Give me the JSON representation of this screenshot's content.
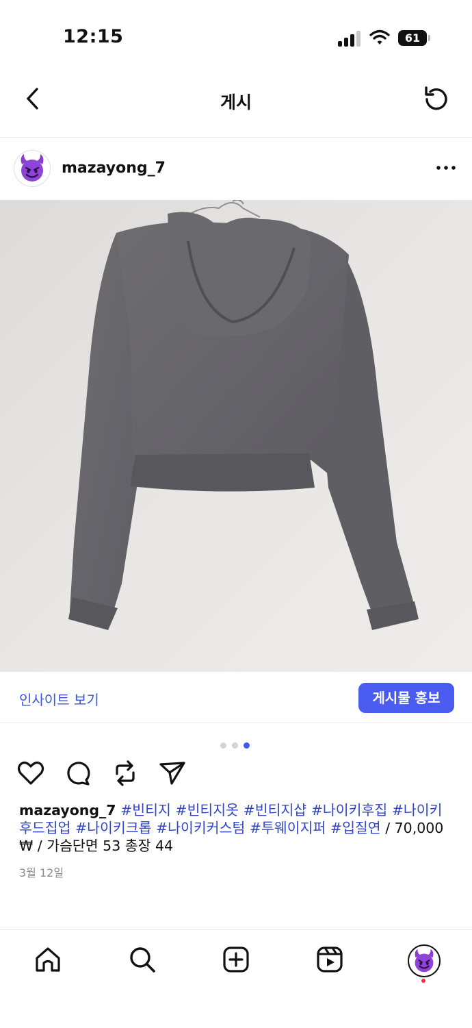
{
  "status_bar": {
    "time": "12:15",
    "battery": "61",
    "signal_bars_filled": 3
  },
  "nav": {
    "title": "게시",
    "back_icon": "chevron-left-icon",
    "refresh_icon": "refresh-icon"
  },
  "post": {
    "username": "mazayong_7",
    "avatar_icon": "devil-emoji-icon",
    "more_icon": "more-horizontal-icon",
    "carousel": {
      "count": 3,
      "active_index": 2
    },
    "insight_label": "인사이트 보기",
    "promote_label": "게시물 홍보",
    "actions": [
      "heart-icon",
      "comment-icon",
      "repost-icon",
      "send-icon"
    ],
    "caption": {
      "username": "mazayong_7",
      "hashtags": [
        "#빈티지",
        "#빈티지옷",
        "#빈티지샵",
        "#나이키후집",
        "#나이키후드집업",
        "#나이키크롭",
        "#나이키커스텀",
        "#투웨이지퍼",
        "#입질연"
      ],
      "text": "/ 70,000 ₩ / 가슴단면 53 총장 44"
    },
    "date": "3월 12일"
  },
  "bottom_nav": [
    "home-icon",
    "search-icon",
    "create-icon",
    "reels-icon",
    "profile-avatar"
  ],
  "colors": {
    "link": "#3755e6",
    "hashtag": "#3345c7",
    "button": "#4a5cf0",
    "notification": "#ff2a42"
  }
}
